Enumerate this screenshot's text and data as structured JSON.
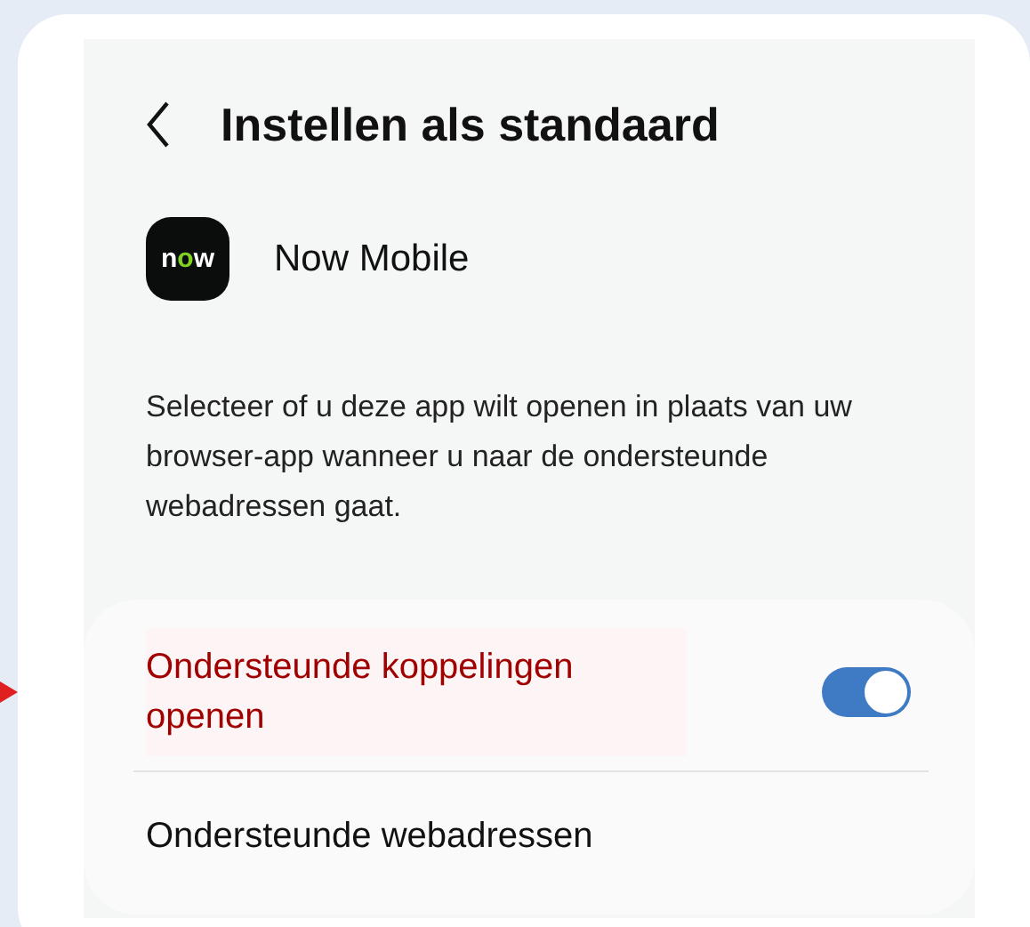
{
  "header": {
    "title": "Instellen als standaard"
  },
  "app": {
    "icon_text": "now",
    "name": "Now Mobile"
  },
  "description": "Selecteer of u deze app wilt openen in plaats van uw browser-app wanneer u naar de ondersteunde webadressen gaat.",
  "settings": [
    {
      "kind": "toggle",
      "label": "Ondersteunde koppelingen openen",
      "on": true,
      "highlighted": true
    },
    {
      "kind": "link",
      "label": "Ondersteunde webadressen",
      "highlighted": false
    }
  ]
}
